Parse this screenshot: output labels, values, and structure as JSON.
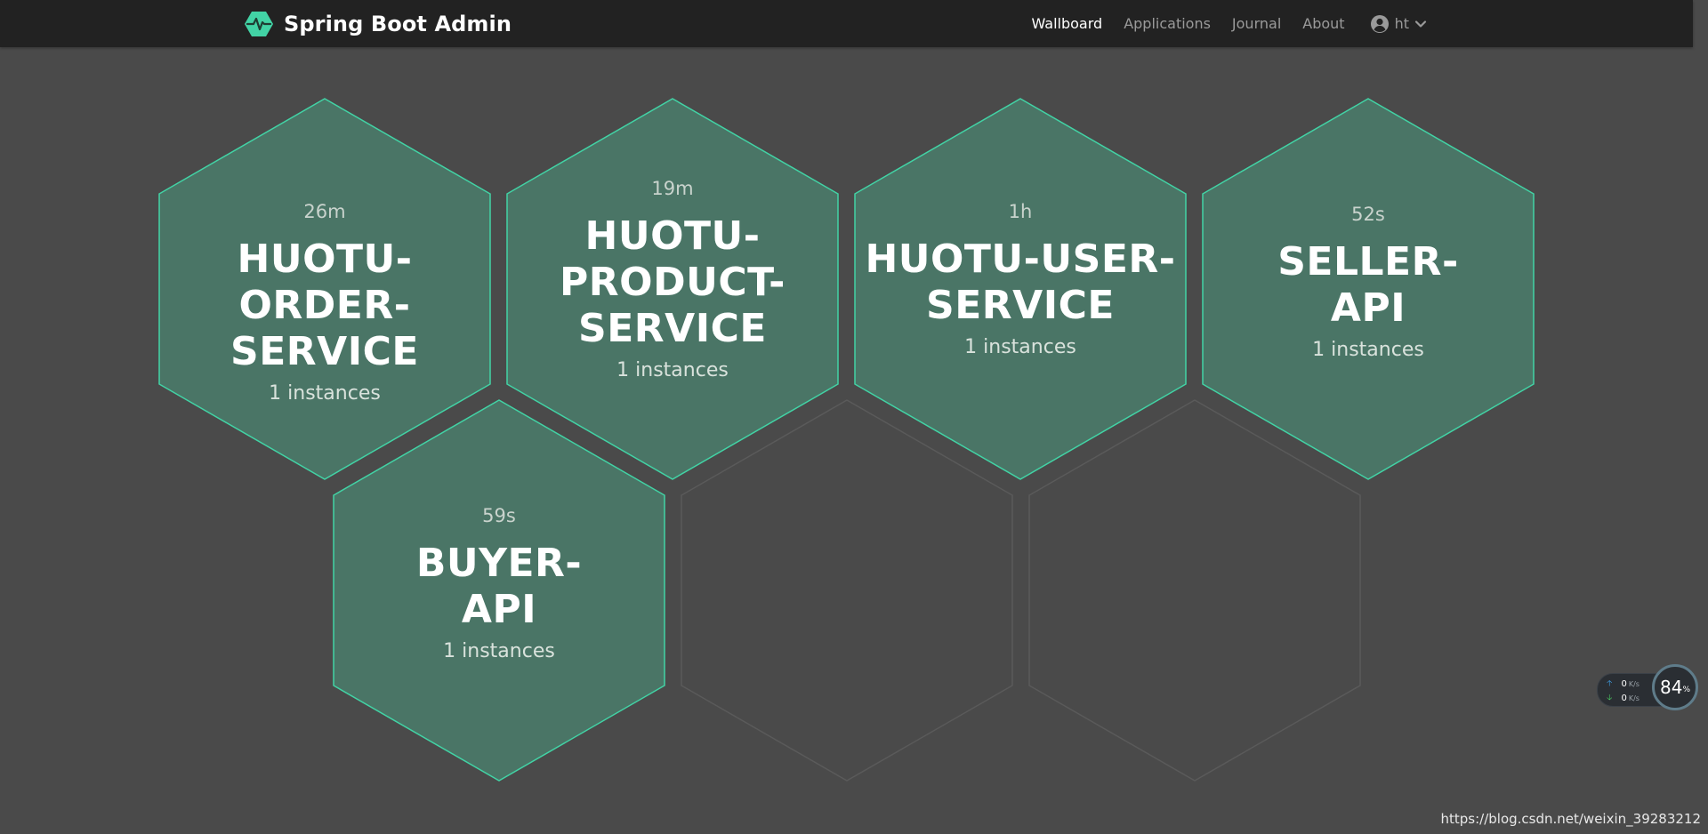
{
  "navbar": {
    "brand": "Spring Boot Admin",
    "links": [
      "Wallboard",
      "Applications",
      "Journal",
      "About"
    ],
    "active_link": "Wallboard",
    "user": "ht",
    "icons": {
      "logo": "heartbeat-hexagon-icon",
      "user": "user-circle-icon",
      "menu": "chevron-down-icon"
    }
  },
  "wallboard": {
    "applications": [
      {
        "uptime": "26m",
        "name_lines": [
          "HUOTU-ORDER-",
          "SERVICE"
        ],
        "instances": "1 instances",
        "status": "UP"
      },
      {
        "uptime": "19m",
        "name_lines": [
          "HUOTU-",
          "PRODUCT-",
          "SERVICE"
        ],
        "instances": "1 instances",
        "status": "UP"
      },
      {
        "uptime": "1h",
        "name_lines": [
          "HUOTU-USER-",
          "SERVICE"
        ],
        "instances": "1 instances",
        "status": "UP"
      },
      {
        "uptime": "52s",
        "name_lines": [
          "SELLER-",
          "API"
        ],
        "instances": "1 instances",
        "status": "UP"
      },
      {
        "uptime": "59s",
        "name_lines": [
          "BUYER-",
          "API"
        ],
        "instances": "1 instances",
        "status": "UP"
      }
    ],
    "empty_slots": 2
  },
  "overlay": {
    "upload": "0",
    "download": "0",
    "unit": "K/s",
    "usage": "84",
    "usage_unit": "%"
  },
  "watermark": "https://blog.csdn.net/weixin_39283212",
  "colors": {
    "navbar_bg": "#222222",
    "page_bg": "#4a4a4a",
    "hex_fill": "#4a7566",
    "hex_stroke": "#42d3a5",
    "empty_hex_stroke": "#5a5a5a",
    "brand_accent": "#42d3a5"
  }
}
